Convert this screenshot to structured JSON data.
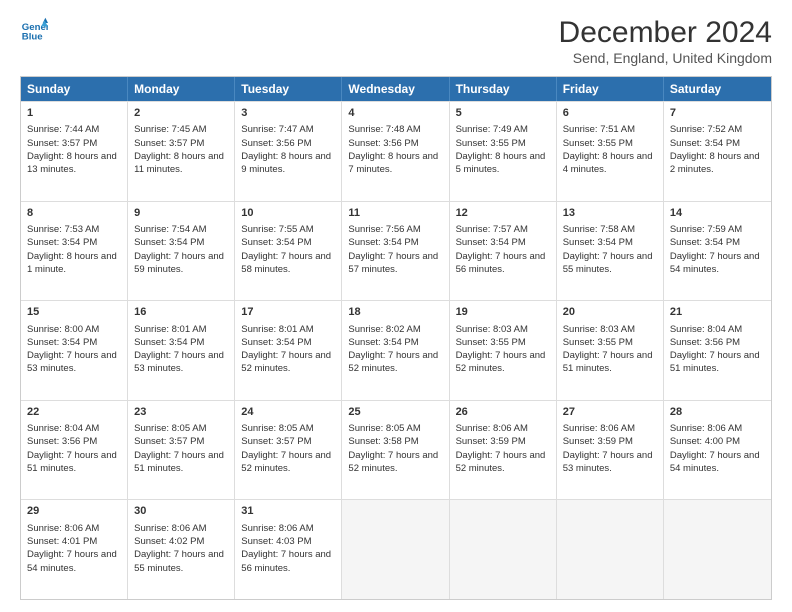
{
  "header": {
    "logo_line1": "General",
    "logo_line2": "Blue",
    "main_title": "December 2024",
    "subtitle": "Send, England, United Kingdom"
  },
  "weekdays": [
    "Sunday",
    "Monday",
    "Tuesday",
    "Wednesday",
    "Thursday",
    "Friday",
    "Saturday"
  ],
  "weeks": [
    [
      {
        "day": "1",
        "sunrise": "Sunrise: 7:44 AM",
        "sunset": "Sunset: 3:57 PM",
        "daylight": "Daylight: 8 hours and 13 minutes."
      },
      {
        "day": "2",
        "sunrise": "Sunrise: 7:45 AM",
        "sunset": "Sunset: 3:57 PM",
        "daylight": "Daylight: 8 hours and 11 minutes."
      },
      {
        "day": "3",
        "sunrise": "Sunrise: 7:47 AM",
        "sunset": "Sunset: 3:56 PM",
        "daylight": "Daylight: 8 hours and 9 minutes."
      },
      {
        "day": "4",
        "sunrise": "Sunrise: 7:48 AM",
        "sunset": "Sunset: 3:56 PM",
        "daylight": "Daylight: 8 hours and 7 minutes."
      },
      {
        "day": "5",
        "sunrise": "Sunrise: 7:49 AM",
        "sunset": "Sunset: 3:55 PM",
        "daylight": "Daylight: 8 hours and 5 minutes."
      },
      {
        "day": "6",
        "sunrise": "Sunrise: 7:51 AM",
        "sunset": "Sunset: 3:55 PM",
        "daylight": "Daylight: 8 hours and 4 minutes."
      },
      {
        "day": "7",
        "sunrise": "Sunrise: 7:52 AM",
        "sunset": "Sunset: 3:54 PM",
        "daylight": "Daylight: 8 hours and 2 minutes."
      }
    ],
    [
      {
        "day": "8",
        "sunrise": "Sunrise: 7:53 AM",
        "sunset": "Sunset: 3:54 PM",
        "daylight": "Daylight: 8 hours and 1 minute."
      },
      {
        "day": "9",
        "sunrise": "Sunrise: 7:54 AM",
        "sunset": "Sunset: 3:54 PM",
        "daylight": "Daylight: 7 hours and 59 minutes."
      },
      {
        "day": "10",
        "sunrise": "Sunrise: 7:55 AM",
        "sunset": "Sunset: 3:54 PM",
        "daylight": "Daylight: 7 hours and 58 minutes."
      },
      {
        "day": "11",
        "sunrise": "Sunrise: 7:56 AM",
        "sunset": "Sunset: 3:54 PM",
        "daylight": "Daylight: 7 hours and 57 minutes."
      },
      {
        "day": "12",
        "sunrise": "Sunrise: 7:57 AM",
        "sunset": "Sunset: 3:54 PM",
        "daylight": "Daylight: 7 hours and 56 minutes."
      },
      {
        "day": "13",
        "sunrise": "Sunrise: 7:58 AM",
        "sunset": "Sunset: 3:54 PM",
        "daylight": "Daylight: 7 hours and 55 minutes."
      },
      {
        "day": "14",
        "sunrise": "Sunrise: 7:59 AM",
        "sunset": "Sunset: 3:54 PM",
        "daylight": "Daylight: 7 hours and 54 minutes."
      }
    ],
    [
      {
        "day": "15",
        "sunrise": "Sunrise: 8:00 AM",
        "sunset": "Sunset: 3:54 PM",
        "daylight": "Daylight: 7 hours and 53 minutes."
      },
      {
        "day": "16",
        "sunrise": "Sunrise: 8:01 AM",
        "sunset": "Sunset: 3:54 PM",
        "daylight": "Daylight: 7 hours and 53 minutes."
      },
      {
        "day": "17",
        "sunrise": "Sunrise: 8:01 AM",
        "sunset": "Sunset: 3:54 PM",
        "daylight": "Daylight: 7 hours and 52 minutes."
      },
      {
        "day": "18",
        "sunrise": "Sunrise: 8:02 AM",
        "sunset": "Sunset: 3:54 PM",
        "daylight": "Daylight: 7 hours and 52 minutes."
      },
      {
        "day": "19",
        "sunrise": "Sunrise: 8:03 AM",
        "sunset": "Sunset: 3:55 PM",
        "daylight": "Daylight: 7 hours and 52 minutes."
      },
      {
        "day": "20",
        "sunrise": "Sunrise: 8:03 AM",
        "sunset": "Sunset: 3:55 PM",
        "daylight": "Daylight: 7 hours and 51 minutes."
      },
      {
        "day": "21",
        "sunrise": "Sunrise: 8:04 AM",
        "sunset": "Sunset: 3:56 PM",
        "daylight": "Daylight: 7 hours and 51 minutes."
      }
    ],
    [
      {
        "day": "22",
        "sunrise": "Sunrise: 8:04 AM",
        "sunset": "Sunset: 3:56 PM",
        "daylight": "Daylight: 7 hours and 51 minutes."
      },
      {
        "day": "23",
        "sunrise": "Sunrise: 8:05 AM",
        "sunset": "Sunset: 3:57 PM",
        "daylight": "Daylight: 7 hours and 51 minutes."
      },
      {
        "day": "24",
        "sunrise": "Sunrise: 8:05 AM",
        "sunset": "Sunset: 3:57 PM",
        "daylight": "Daylight: 7 hours and 52 minutes."
      },
      {
        "day": "25",
        "sunrise": "Sunrise: 8:05 AM",
        "sunset": "Sunset: 3:58 PM",
        "daylight": "Daylight: 7 hours and 52 minutes."
      },
      {
        "day": "26",
        "sunrise": "Sunrise: 8:06 AM",
        "sunset": "Sunset: 3:59 PM",
        "daylight": "Daylight: 7 hours and 52 minutes."
      },
      {
        "day": "27",
        "sunrise": "Sunrise: 8:06 AM",
        "sunset": "Sunset: 3:59 PM",
        "daylight": "Daylight: 7 hours and 53 minutes."
      },
      {
        "day": "28",
        "sunrise": "Sunrise: 8:06 AM",
        "sunset": "Sunset: 4:00 PM",
        "daylight": "Daylight: 7 hours and 54 minutes."
      }
    ],
    [
      {
        "day": "29",
        "sunrise": "Sunrise: 8:06 AM",
        "sunset": "Sunset: 4:01 PM",
        "daylight": "Daylight: 7 hours and 54 minutes."
      },
      {
        "day": "30",
        "sunrise": "Sunrise: 8:06 AM",
        "sunset": "Sunset: 4:02 PM",
        "daylight": "Daylight: 7 hours and 55 minutes."
      },
      {
        "day": "31",
        "sunrise": "Sunrise: 8:06 AM",
        "sunset": "Sunset: 4:03 PM",
        "daylight": "Daylight: 7 hours and 56 minutes."
      },
      null,
      null,
      null,
      null
    ]
  ]
}
